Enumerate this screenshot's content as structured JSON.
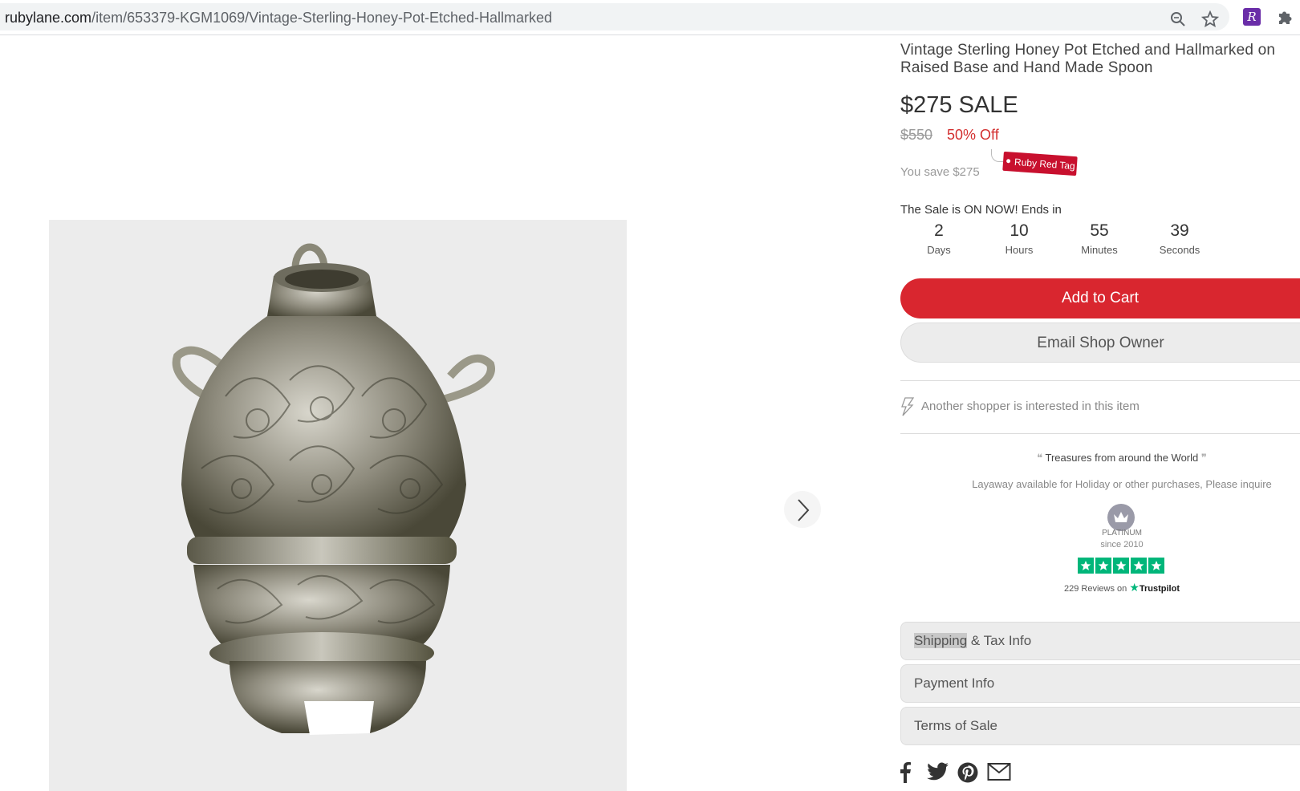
{
  "browser": {
    "url_host": "rubylane.com",
    "url_path": "/item/653379-KGM1069/Vintage-Sterling-Honey-Pot-Etched-Hallmarked",
    "icons": [
      "zoom-icon",
      "bookmark-star-icon",
      "ruby-lane-extension-icon",
      "extensions-puzzle-icon"
    ],
    "extension_letter": "R"
  },
  "product": {
    "title": "Vintage Sterling Honey Pot Etched and Hallmarked on Raised Base and Hand Made Spoon",
    "price": "$275 SALE",
    "original_price": "$550",
    "discount": "50% Off",
    "you_save": "You save $275",
    "tag_label": "Ruby Red Tag"
  },
  "sale": {
    "headline": "The Sale is ON NOW! Ends in",
    "countdown": [
      {
        "value": "2",
        "label": "Days"
      },
      {
        "value": "10",
        "label": "Hours"
      },
      {
        "value": "55",
        "label": "Minutes"
      },
      {
        "value": "39",
        "label": "Seconds"
      }
    ]
  },
  "actions": {
    "add_to_cart": "Add to Cart",
    "email_shop_owner": "Email Shop Owner"
  },
  "interest_text": "Another shopper is interested in this item",
  "shop": {
    "tagline": "Treasures from around the World",
    "layaway": "Layaway available for Holiday or other purchases, Please inquire",
    "level": "PLATINUM",
    "since": "since 2010",
    "reviews_text": "229 Reviews on",
    "reviews_brand": "Trustpilot",
    "rating_stars": 5
  },
  "accordion": {
    "shipping_highlight": "Shipping",
    "shipping_rest": " & Tax Info",
    "payment": "Payment Info",
    "terms": "Terms of Sale"
  },
  "share_icons": [
    "facebook-icon",
    "twitter-icon",
    "pinterest-icon",
    "email-icon"
  ],
  "colors": {
    "accent_red": "#d9262f",
    "discount_red": "#d32f2f",
    "trustpilot_green": "#00b67a",
    "extension_purple": "#6a2da8"
  }
}
